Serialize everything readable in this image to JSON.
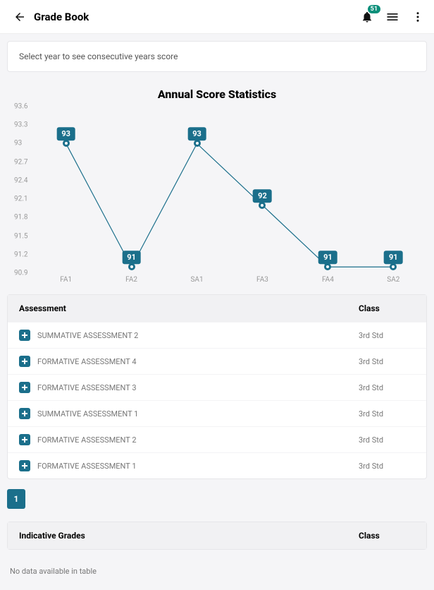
{
  "header": {
    "title": "Grade Book",
    "notification_count": "51"
  },
  "year_select_placeholder": "Select year to see consecutive years score",
  "chart_data": {
    "type": "line",
    "title": "Annual Score Statistics",
    "categories": [
      "FA1",
      "FA2",
      "SA1",
      "FA3",
      "FA4",
      "SA2"
    ],
    "values": [
      93,
      91,
      93,
      92,
      91,
      91
    ],
    "ylabel": "",
    "xlabel": "",
    "ylim": [
      90.9,
      93.6
    ],
    "yticks": [
      93.6,
      93.3,
      93,
      92.7,
      92.4,
      92.1,
      91.8,
      91.5,
      91.2,
      90.9
    ]
  },
  "assessment_table": {
    "headers": {
      "col1": "Assessment",
      "col2": "Class"
    },
    "rows": [
      {
        "name": "SUMMATIVE ASSESSMENT 2",
        "class": "3rd Std"
      },
      {
        "name": "FORMATIVE ASSESSMENT 4",
        "class": "3rd Std"
      },
      {
        "name": "FORMATIVE ASSESSMENT 3",
        "class": "3rd Std"
      },
      {
        "name": "SUMMATIVE ASSESSMENT 1",
        "class": "3rd Std"
      },
      {
        "name": "FORMATIVE ASSESSMENT 2",
        "class": "3rd Std"
      },
      {
        "name": "FORMATIVE ASSESSMENT 1",
        "class": "3rd Std"
      }
    ]
  },
  "pagination": {
    "current": "1"
  },
  "indicative_grades": {
    "headers": {
      "col1": "Indicative Grades",
      "col2": "Class"
    },
    "empty_text": "No data available in table"
  }
}
